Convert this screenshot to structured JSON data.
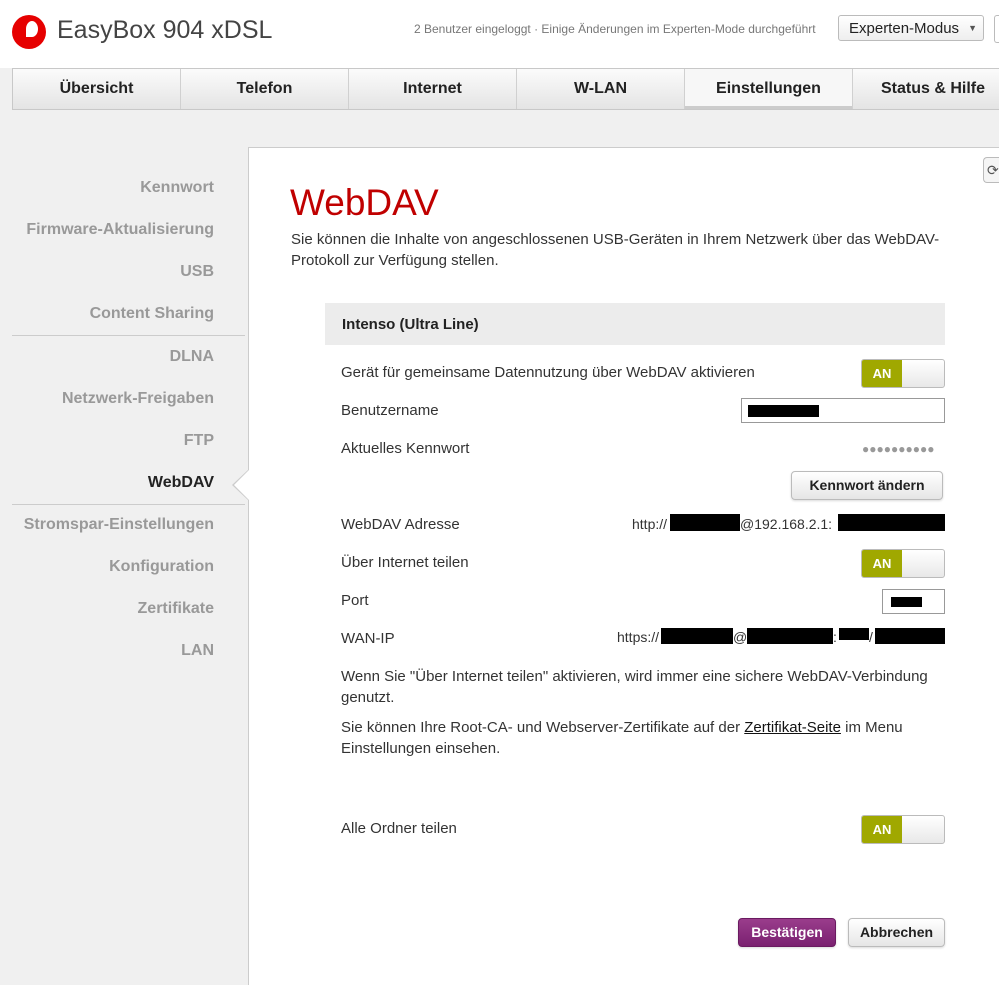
{
  "header": {
    "app_title": "EasyBox 904 xDSL",
    "status_text": "2 Benutzer eingeloggt · Einige Änderungen im Experten-Mode durchgeführt",
    "mode_select_value": "Experten-Modus",
    "logo_color": "#e60000"
  },
  "nav": {
    "tabs": [
      {
        "label": "Übersicht"
      },
      {
        "label": "Telefon"
      },
      {
        "label": "Internet"
      },
      {
        "label": "W-LAN"
      },
      {
        "label": "Einstellungen"
      },
      {
        "label": "Status & Hilfe"
      }
    ],
    "active_tab": "Einstellungen"
  },
  "sidebar": {
    "items": [
      {
        "label": "Kennwort"
      },
      {
        "label": "Firmware-Aktualisierung"
      },
      {
        "label": "USB"
      },
      {
        "label": "Content Sharing"
      },
      {
        "label": "DLNA"
      },
      {
        "label": "Netzwerk-Freigaben"
      },
      {
        "label": "FTP"
      },
      {
        "label": "WebDAV"
      },
      {
        "label": "Stromspar-Einstellungen"
      },
      {
        "label": "Konfiguration"
      },
      {
        "label": "Zertifikate"
      },
      {
        "label": "LAN"
      }
    ],
    "active_item": "WebDAV"
  },
  "main": {
    "title": "WebDAV",
    "description": "Sie können die Inhalte von angeschlossenen USB-Geräten in Ihrem Netzwerk über das WebDAV-Protokoll zur Verfügung stellen.",
    "device_name": "Intenso (Ultra Line)",
    "fields": {
      "activate_label": "Gerät für gemeinsame Datennutzung über WebDAV aktivieren",
      "activate_state": "AN",
      "username_label": "Benutzername",
      "password_label": "Aktuelles Kennwort",
      "password_dots": "●●●●●●●●●●",
      "change_password_button": "Kennwort ändern",
      "address_label": "WebDAV Adresse",
      "address_prefix": "http://",
      "address_mid": "@192.168.2.1:",
      "share_internet_label": "Über Internet teilen",
      "share_internet_state": "AN",
      "port_label": "Port",
      "wan_ip_label": "WAN-IP",
      "wan_prefix": "https://",
      "wan_at": "@",
      "wan_colon": ":",
      "wan_slash": "/",
      "all_folders_label": "Alle Ordner teilen",
      "all_folders_state": "AN"
    },
    "info1": "Wenn Sie \"Über Internet teilen\" aktivieren, wird immer eine sichere WebDAV-Verbindung genutzt.",
    "info2_before": "Sie können Ihre Root-CA- und Webserver-Zertifikate auf der ",
    "info2_link": "Zertifikat-Seite",
    "info2_after": " im Menu Einstellungen einsehen.",
    "confirm_button": "Bestätigen",
    "cancel_button": "Abbrechen",
    "title_color": "#c00000",
    "toggle_on_color": "#a0a800",
    "primary_button_color": "#7a2070"
  }
}
